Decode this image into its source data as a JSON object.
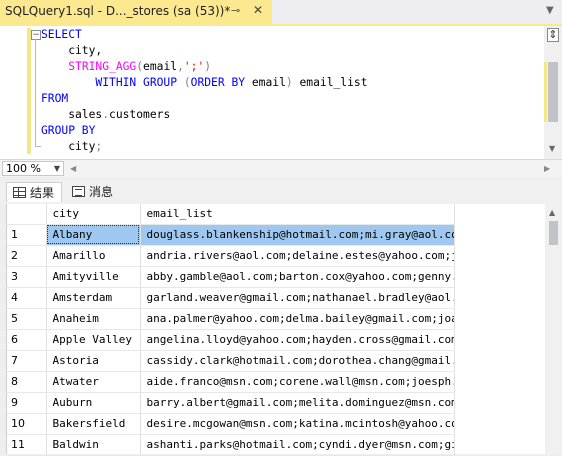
{
  "tab": {
    "title": "SQLQuery1.sql - D..._stores (sa (53))*",
    "pin_icon": "pin-icon",
    "close_icon": "close-icon"
  },
  "editor": {
    "lines": [
      [
        {
          "t": "SELECT",
          "c": "kw"
        }
      ],
      [
        {
          "t": "    city,",
          "c": "id"
        }
      ],
      [
        {
          "t": "    ",
          "c": "id"
        },
        {
          "t": "STRING_AGG",
          "c": "fn"
        },
        {
          "t": "(",
          "c": "gray"
        },
        {
          "t": "email",
          "c": "id"
        },
        {
          "t": ",",
          "c": "gray"
        },
        {
          "t": "';'",
          "c": "str"
        },
        {
          "t": ")",
          "c": "gray"
        }
      ],
      [
        {
          "t": "        ",
          "c": "id"
        },
        {
          "t": "WITHIN GROUP",
          "c": "kw"
        },
        {
          "t": " (",
          "c": "gray"
        },
        {
          "t": "ORDER BY",
          "c": "kw"
        },
        {
          "t": " email",
          "c": "id"
        },
        {
          "t": ")",
          "c": "gray"
        },
        {
          "t": " email_list",
          "c": "id"
        }
      ],
      [
        {
          "t": "FROM",
          "c": "kw"
        }
      ],
      [
        {
          "t": "    sales",
          "c": "id"
        },
        {
          "t": ".",
          "c": "gray"
        },
        {
          "t": "customers",
          "c": "id"
        }
      ],
      [
        {
          "t": "GROUP BY",
          "c": "kw"
        }
      ],
      [
        {
          "t": "    city",
          "c": "id"
        },
        {
          "t": ";",
          "c": "gray"
        }
      ]
    ]
  },
  "zoom": {
    "value": "100 %"
  },
  "result_tabs": {
    "results": "结果",
    "messages": "消息"
  },
  "results": {
    "columns": [
      "",
      "city",
      "email_list"
    ],
    "rows": [
      [
        "1",
        "Albany",
        "douglass.blankenship@hotmail.com;mi.gray@aol.co..."
      ],
      [
        "2",
        "Amarillo",
        "andria.rivers@aol.com;delaine.estes@yahoo.com;j..."
      ],
      [
        "3",
        "Amityville",
        "abby.gamble@aol.com;barton.cox@yahoo.com;genny...."
      ],
      [
        "4",
        "Amsterdam",
        "garland.weaver@gmail.com;nathanael.bradley@aol...."
      ],
      [
        "5",
        "Anaheim",
        "ana.palmer@yahoo.com;delma.bailey@gmail.com;joa..."
      ],
      [
        "6",
        "Apple Valley",
        "angelina.lloyd@yahoo.com;hayden.cross@gmail.com..."
      ],
      [
        "7",
        "Astoria",
        "cassidy.clark@hotmail.com;dorothea.chang@gmail...."
      ],
      [
        "8",
        "Atwater",
        "aide.franco@msn.com;corene.wall@msn.com;joesph...."
      ],
      [
        "9",
        "Auburn",
        "barry.albert@gmail.com;melita.dominguez@msn.com..."
      ],
      [
        "10",
        "Bakersfield",
        "desire.mcgowan@msn.com;katina.mcintosh@yahoo.co..."
      ],
      [
        "11",
        "Baldwin",
        "ashanti.parks@hotmail.com;cyndi.dyer@msn.com;gi..."
      ]
    ],
    "selected_row": 0
  },
  "colors": {
    "tab_active": "#fbe88f",
    "selection": "#9ec8f0",
    "keyword": "#0000ff",
    "function": "#ff00ff",
    "string": "#ff0000"
  }
}
